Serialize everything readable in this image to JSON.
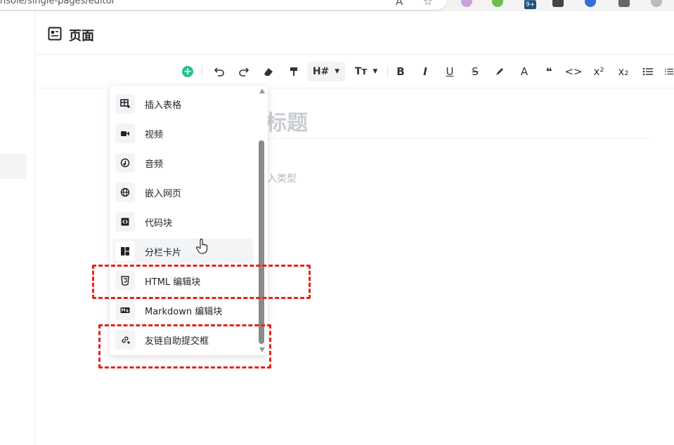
{
  "browser": {
    "url_fragment": "nsole/single-pages/editor",
    "ext_badge": "9+"
  },
  "header": {
    "title": "页面"
  },
  "toolbar": {
    "heading_label": "H#",
    "text_size_label": "Tт",
    "bold": "B",
    "italic": "I",
    "underline": "U",
    "strike": "S",
    "font_color": "A",
    "quote": "❝",
    "code": "<>",
    "superscript": "x²",
    "subscript": "x₂"
  },
  "editor": {
    "title_placeholder": "标题",
    "body_hint": "入类型"
  },
  "insert_menu": {
    "items": [
      {
        "label": "插入表格",
        "icon": "table-insert-icon"
      },
      {
        "label": "视频",
        "icon": "video-icon"
      },
      {
        "label": "音频",
        "icon": "audio-icon"
      },
      {
        "label": "嵌入网页",
        "icon": "globe-icon"
      },
      {
        "label": "代码块",
        "icon": "code-block-icon"
      },
      {
        "label": "分栏卡片",
        "icon": "columns-icon"
      },
      {
        "label": "HTML 编辑块",
        "icon": "html5-icon"
      },
      {
        "label": "Markdown 编辑块",
        "icon": "markdown-icon"
      },
      {
        "label": "友链自助提交框",
        "icon": "link-add-icon"
      }
    ]
  },
  "colors": {
    "accent_green": "#27c28a",
    "highlight_red": "#e8211a"
  }
}
